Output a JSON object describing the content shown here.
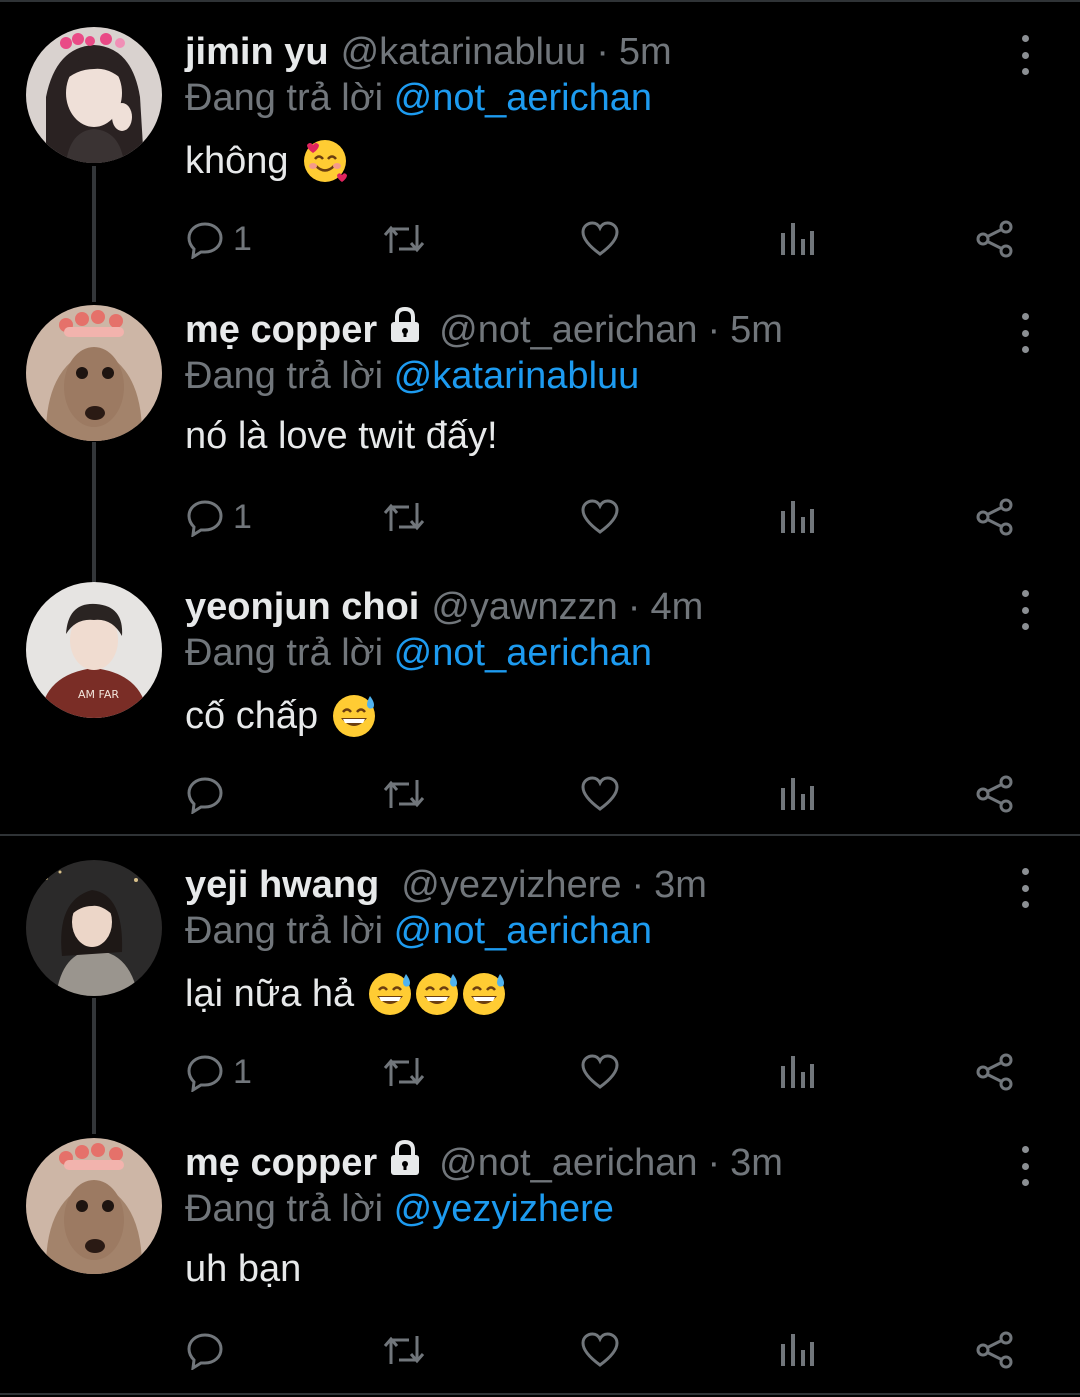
{
  "colors": {
    "background": "#000000",
    "text": "#e7e9ea",
    "muted": "#71767b",
    "mention": "#1d9bf0",
    "divider": "#2f3336"
  },
  "replying_label": "Đang trả lời",
  "tweets": [
    {
      "name": "jimin yu",
      "locked": false,
      "handle": "@katarinabluu",
      "separator": "·",
      "time": "5m",
      "reply_to": "@not_aerichan",
      "text": "không",
      "emojis": [
        "smiling-face-with-hearts"
      ],
      "reply_count": "1",
      "icons": {
        "reply": "reply-icon",
        "retweet": "retweet-icon",
        "like": "heart-icon",
        "views": "analytics-icon",
        "share": "share-icon",
        "more": "more-icon"
      }
    },
    {
      "name": "mẹ copper",
      "locked": true,
      "handle": "@not_aerichan",
      "separator": "·",
      "time": "5m",
      "reply_to": "@katarinabluu",
      "text": "nó là love twit đấy!",
      "emojis": [],
      "reply_count": "1"
    },
    {
      "name": "yeonjun choi",
      "locked": false,
      "handle": "@yawnzzn",
      "separator": "·",
      "time": "4m",
      "reply_to": "@not_aerichan",
      "text": "cố chấp",
      "emojis": [
        "grinning-face-with-sweat"
      ],
      "reply_count": ""
    },
    {
      "name": "yeji hwang",
      "locked": false,
      "handle": "@yezyizhere",
      "separator": "·",
      "time": "3m",
      "reply_to": "@not_aerichan",
      "text": "lại nữa hả",
      "emojis": [
        "grinning-face-with-sweat",
        "grinning-face-with-sweat",
        "grinning-face-with-sweat"
      ],
      "reply_count": "1"
    },
    {
      "name": "mẹ copper",
      "locked": true,
      "handle": "@not_aerichan",
      "separator": "·",
      "time": "3m",
      "reply_to": "@yezyizhere",
      "text": "uh bạn",
      "emojis": [],
      "reply_count": ""
    }
  ]
}
